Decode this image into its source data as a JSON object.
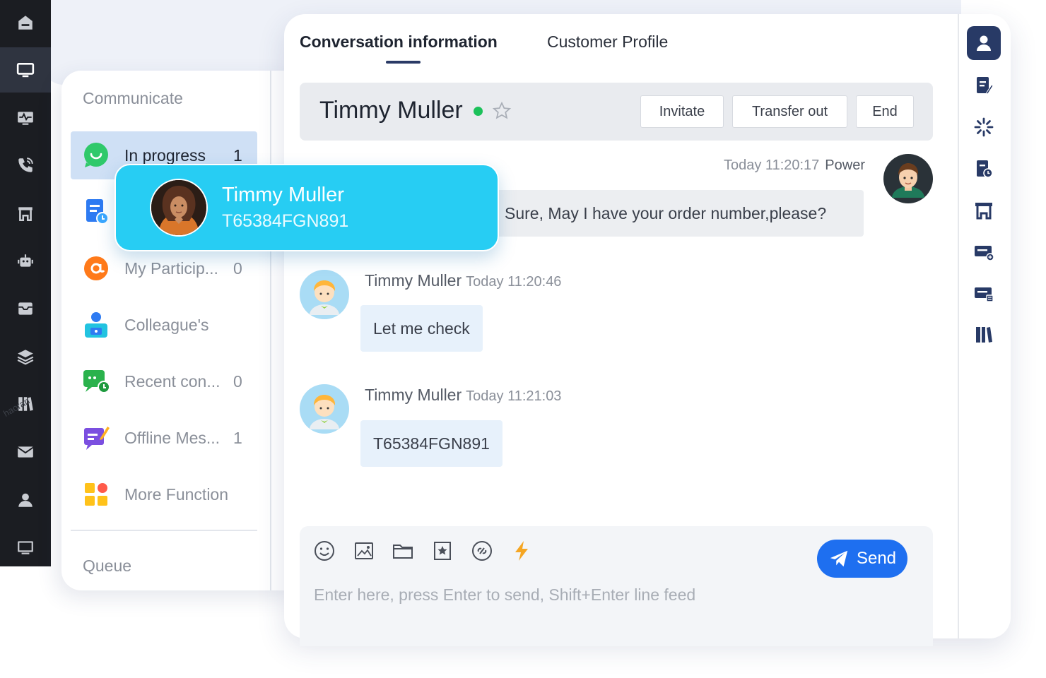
{
  "rail": {
    "items": [
      {
        "icon": "home-icon",
        "active": false
      },
      {
        "icon": "monitor-icon",
        "active": true
      },
      {
        "icon": "activity-monitor-icon",
        "active": false
      },
      {
        "icon": "phone-icon",
        "active": false
      },
      {
        "icon": "shop-icon",
        "active": false
      },
      {
        "icon": "robot-icon",
        "active": false
      },
      {
        "icon": "inbox-icon",
        "active": false
      },
      {
        "icon": "layers-icon",
        "active": false
      },
      {
        "icon": "books-icon",
        "active": false
      },
      {
        "icon": "mail-icon",
        "active": false
      },
      {
        "icon": "user-icon",
        "active": false
      },
      {
        "icon": "display-icon",
        "active": false
      }
    ],
    "watermark": "haoran"
  },
  "communicate": {
    "title": "Communicate",
    "items": [
      {
        "label": "In progress",
        "count": "1",
        "icon": "chat-bubble-icon",
        "active": true
      },
      {
        "label": "",
        "count": "",
        "icon": "document-clock-icon",
        "active": false
      },
      {
        "label": "My Particip...",
        "count": "0",
        "icon": "at-sign-icon",
        "active": false
      },
      {
        "label": "Colleague's",
        "count": "",
        "icon": "colleague-icon",
        "active": false
      },
      {
        "label": "Recent con...",
        "count": "0",
        "icon": "recent-chat-icon",
        "active": false
      },
      {
        "label": "Offline Mes...",
        "count": "1",
        "icon": "offline-message-icon",
        "active": false
      },
      {
        "label": "More Function",
        "count": "",
        "icon": "grid-apps-icon",
        "active": false
      }
    ],
    "queue_title": "Queue"
  },
  "popup": {
    "name": "Timmy Muller",
    "id": "T65384FGN891"
  },
  "tabs": {
    "conversation": "Conversation information",
    "profile": "Customer Profile"
  },
  "header": {
    "name": "Timmy Muller",
    "status_color": "#1cc15a",
    "buttons": {
      "invitate": "Invitate",
      "transfer": "Transfer out",
      "end": "End"
    }
  },
  "messages": {
    "agent": {
      "time": "Today 11:20:17",
      "sender": "Power",
      "text": "Sure, May I have your order number,please?"
    },
    "customer": [
      {
        "sender": "Timmy Muller",
        "time": "Today 11:20:46",
        "text": "Let me check"
      },
      {
        "sender": "Timmy Muller",
        "time": "Today 11:21:03",
        "text": "T65384FGN891"
      }
    ]
  },
  "composer": {
    "tools": [
      "emoji-icon",
      "image-icon",
      "folder-icon",
      "favorite-icon",
      "link-icon",
      "quick-reply-icon"
    ],
    "send_label": "Send",
    "placeholder": "Enter here, press Enter to send, Shift+Enter line feed",
    "value": ""
  },
  "right_toolbar": {
    "items": [
      {
        "icon": "customer-profile-icon",
        "active": true
      },
      {
        "icon": "edit-note-icon",
        "active": false
      },
      {
        "icon": "loading-icon",
        "active": false
      },
      {
        "icon": "order-history-icon",
        "active": false
      },
      {
        "icon": "store-icon",
        "active": false
      },
      {
        "icon": "ticket-add-icon",
        "active": false
      },
      {
        "icon": "ticket-list-icon",
        "active": false
      },
      {
        "icon": "knowledge-base-icon",
        "active": false
      }
    ]
  },
  "colors": {
    "accent": "#1e6ff0",
    "popup": "#27cdf3",
    "rail": "#1b1d22",
    "active_tool": "#283a66"
  }
}
